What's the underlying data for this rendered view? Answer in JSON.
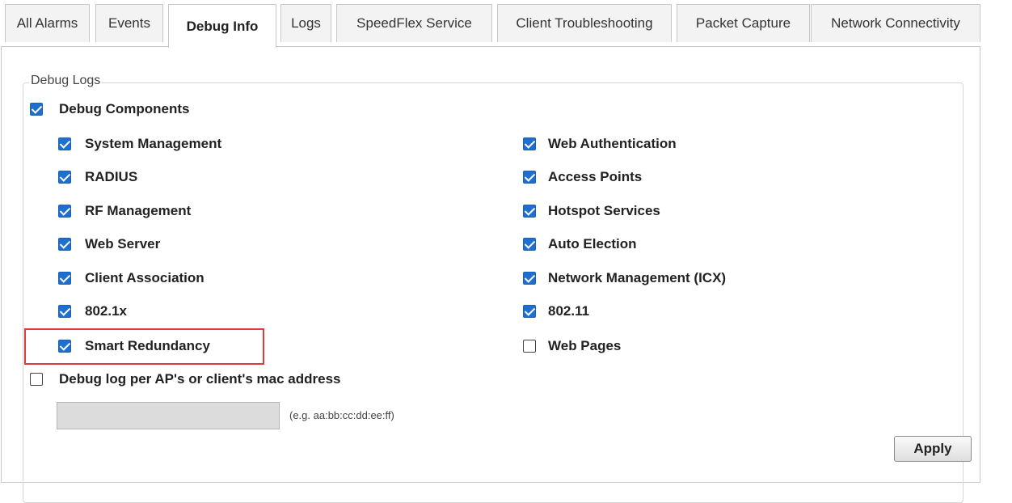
{
  "tabs": [
    {
      "label": "All Alarms"
    },
    {
      "label": "Events"
    },
    {
      "label": "Debug Info"
    },
    {
      "label": "Logs"
    },
    {
      "label": "SpeedFlex Service"
    },
    {
      "label": "Client Troubleshooting"
    },
    {
      "label": "Packet Capture"
    },
    {
      "label": "Network Connectivity"
    }
  ],
  "active_tab": "Debug Info",
  "debug_logs": {
    "legend": "Debug Logs",
    "debug_components": {
      "label": "Debug Components",
      "checked": true
    },
    "left_items": [
      {
        "label": "System Management",
        "checked": true
      },
      {
        "label": "RADIUS",
        "checked": true
      },
      {
        "label": "RF Management",
        "checked": true
      },
      {
        "label": "Web Server",
        "checked": true
      },
      {
        "label": "Client Association",
        "checked": true
      },
      {
        "label": "802.1x",
        "checked": true
      },
      {
        "label": "Smart Redundancy",
        "checked": true
      }
    ],
    "right_items": [
      {
        "label": "Web Authentication",
        "checked": true
      },
      {
        "label": "Access Points",
        "checked": true
      },
      {
        "label": "Hotspot Services",
        "checked": true
      },
      {
        "label": "Auto Election",
        "checked": true
      },
      {
        "label": "Network Management (ICX)",
        "checked": true
      },
      {
        "label": "802.11",
        "checked": true
      },
      {
        "label": "Web Pages",
        "checked": false
      }
    ],
    "mac_option": {
      "label": "Debug log per AP's or client's mac address",
      "checked": false
    },
    "mac_input": {
      "value": "",
      "hint": "(e.g. aa:bb:cc:dd:ee:ff)"
    },
    "apply_label": "Apply"
  },
  "colors": {
    "checkbox_on": "#1f6fd1",
    "highlight": "#e03a3a"
  }
}
